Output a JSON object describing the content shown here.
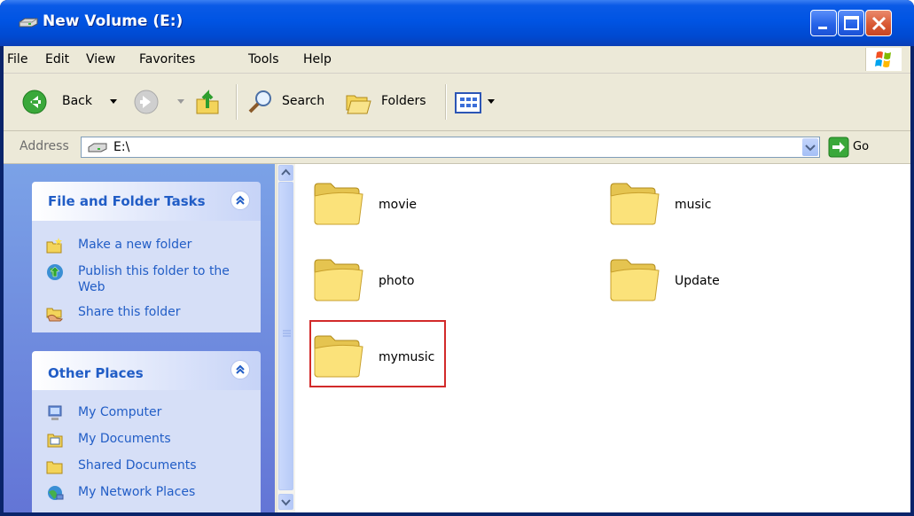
{
  "window": {
    "title": "New Volume (E:)"
  },
  "menu": [
    "File",
    "Edit",
    "View",
    "Favorites",
    "Tools",
    "Help"
  ],
  "toolbar": {
    "back": "Back",
    "search": "Search",
    "folders": "Folders"
  },
  "address": {
    "label": "Address",
    "value": "E:\\",
    "go": "Go"
  },
  "tasks": {
    "title": "File and Folder Tasks",
    "items": [
      "Make a new folder",
      "Publish this folder to the Web",
      "Share this folder"
    ]
  },
  "places": {
    "title": "Other Places",
    "items": [
      "My Computer",
      "My Documents",
      "Shared Documents",
      "My Network Places"
    ]
  },
  "files": [
    "movie",
    "music",
    "photo",
    "Update",
    "mymusic"
  ],
  "colors": {
    "title_bar": "#0054e3",
    "task_link": "#215dc6",
    "highlight_border": "#d22a2a",
    "folder_fill": "#fbe27a"
  }
}
